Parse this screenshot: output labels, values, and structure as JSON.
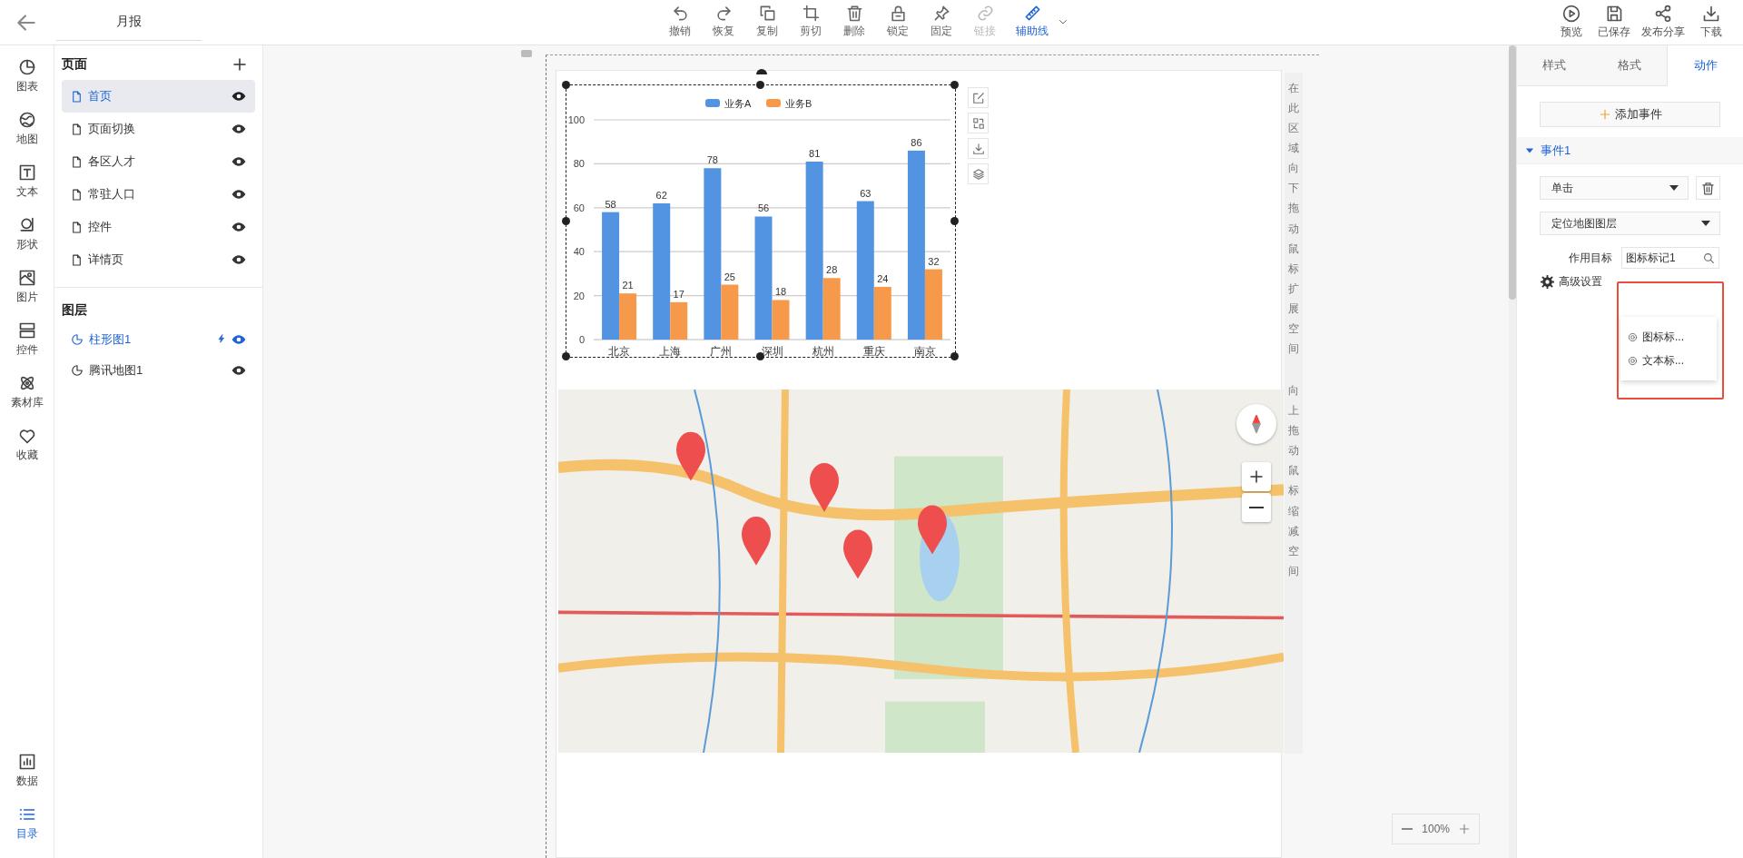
{
  "header": {
    "title": "月报"
  },
  "toolbar": [
    {
      "label": "撤销",
      "disabled": false,
      "active": false
    },
    {
      "label": "恢复",
      "disabled": false,
      "active": false
    },
    {
      "label": "复制",
      "disabled": false,
      "active": false
    },
    {
      "label": "剪切",
      "disabled": false,
      "active": false
    },
    {
      "label": "删除",
      "disabled": false,
      "active": false
    },
    {
      "label": "锁定",
      "disabled": false,
      "active": false
    },
    {
      "label": "固定",
      "disabled": false,
      "active": false
    },
    {
      "label": "链接",
      "disabled": true,
      "active": false
    },
    {
      "label": "辅助线",
      "disabled": false,
      "active": true
    }
  ],
  "actions": [
    {
      "label": "预览"
    },
    {
      "label": "已保存"
    },
    {
      "label": "发布分享"
    },
    {
      "label": "下载"
    }
  ],
  "rail": {
    "items": [
      {
        "label": "图表",
        "selected": false
      },
      {
        "label": "地图",
        "selected": false
      },
      {
        "label": "文本",
        "selected": false
      },
      {
        "label": "形状",
        "selected": false
      },
      {
        "label": "图片",
        "selected": false
      },
      {
        "label": "控件",
        "selected": false
      },
      {
        "label": "素材库",
        "selected": false
      },
      {
        "label": "收藏",
        "selected": false
      }
    ],
    "bottom_items": [
      {
        "label": "数据",
        "selected": false
      },
      {
        "label": "目录",
        "selected": true
      }
    ]
  },
  "pages": {
    "title": "页面",
    "items": [
      {
        "label": "首页",
        "selected": true
      },
      {
        "label": "页面切换",
        "selected": false
      },
      {
        "label": "各区人才",
        "selected": false
      },
      {
        "label": "常驻人口",
        "selected": false
      },
      {
        "label": "控件",
        "selected": false
      },
      {
        "label": "详情页",
        "selected": false
      }
    ]
  },
  "layers": {
    "title": "图层",
    "items": [
      {
        "label": "柱形图1",
        "selected": true,
        "has_event": true
      },
      {
        "label": "腾讯地图1",
        "selected": false,
        "has_event": false
      }
    ]
  },
  "chart": {
    "chart_data": {
      "type": "bar",
      "categories": [
        "北京",
        "上海",
        "广州",
        "深圳",
        "杭州",
        "重庆",
        "南京"
      ],
      "series": [
        {
          "name": "业务A",
          "color": "#5294e2",
          "values": [
            58,
            62,
            78,
            56,
            81,
            63,
            86
          ]
        },
        {
          "name": "业务B",
          "color": "#f7994a",
          "values": [
            21,
            17,
            25,
            18,
            28,
            24,
            32
          ]
        }
      ],
      "ylim": [
        0,
        100
      ],
      "yticks": [
        0,
        20,
        40,
        60,
        80,
        100
      ],
      "data_labels": true,
      "grid": true,
      "legend": true
    }
  },
  "hint_column": {
    "down": "在此区域向下拖动鼠标扩展空间",
    "up": "向上拖动鼠标缩减空间"
  },
  "zoom": {
    "value": "100%"
  },
  "panel": {
    "tabs": [
      {
        "label": "样式",
        "selected": false
      },
      {
        "label": "格式",
        "selected": false
      },
      {
        "label": "动作",
        "selected": true
      }
    ],
    "add_button": "添加事件",
    "event": {
      "title": "事件1",
      "expanded": true,
      "trigger": "单击",
      "action": "定位地图图层",
      "target_label": "作用目标",
      "target_value": "图标标记1",
      "advanced": "高级设置",
      "options": [
        {
          "label": "图标标..."
        },
        {
          "label": "文本标..."
        }
      ]
    }
  }
}
